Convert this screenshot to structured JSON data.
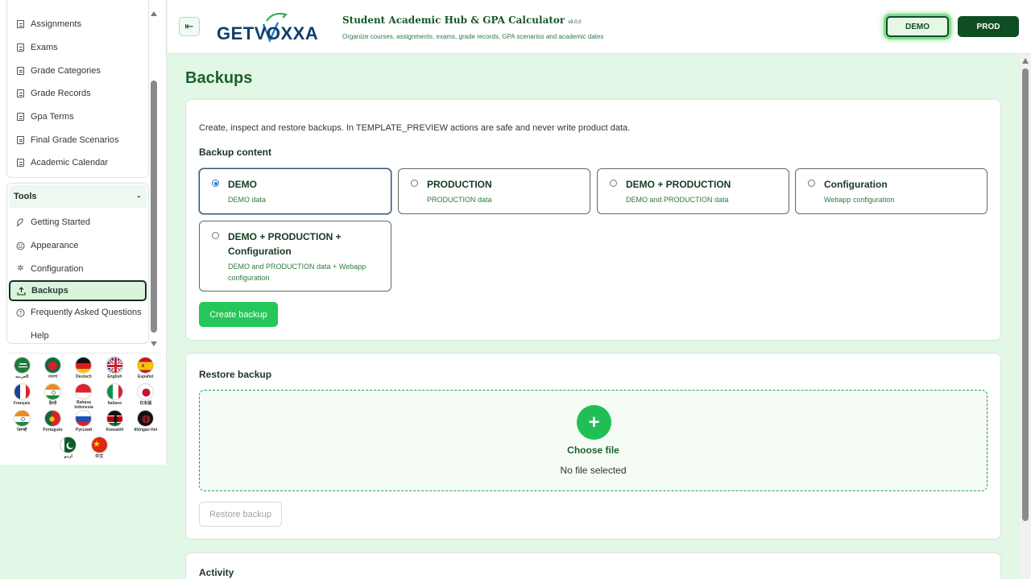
{
  "sidebar": {
    "nav_items": [
      "Assignments",
      "Exams",
      "Grade Categories",
      "Grade Records",
      "Gpa Terms",
      "Final Grade Scenarios",
      "Academic Calendar"
    ],
    "tools": {
      "heading": "Tools",
      "toggle": "-",
      "items": [
        {
          "label": "Getting Started",
          "icon": "rocket-icon"
        },
        {
          "label": "Appearance",
          "icon": "palette-icon"
        },
        {
          "label": "Configuration",
          "icon": "gear-icon"
        },
        {
          "label": "Backups",
          "icon": "upload-icon",
          "active": true
        },
        {
          "label": "Frequently Asked Questions",
          "icon": "question-icon"
        },
        {
          "label": "Help",
          "icon": ""
        }
      ]
    },
    "languages": [
      {
        "label": "العربية",
        "flag": "saudi-arabia"
      },
      {
        "label": "বাংলা",
        "flag": "bangladesh"
      },
      {
        "label": "Deutsch",
        "flag": "germany"
      },
      {
        "label": "English",
        "flag": "united-kingdom",
        "selected": true
      },
      {
        "label": "Español",
        "flag": "spain"
      },
      {
        "label": "Français",
        "flag": "france"
      },
      {
        "label": "हिन्दी",
        "flag": "india"
      },
      {
        "label": "Bahasa Indonesia",
        "flag": "indonesia"
      },
      {
        "label": "Italiano",
        "flag": "italy"
      },
      {
        "label": "日本語",
        "flag": "japan"
      },
      {
        "label": "ਪੰਜਾਬੀ",
        "flag": "india"
      },
      {
        "label": "Português",
        "flag": "portugal"
      },
      {
        "label": "Русский",
        "flag": "russia"
      },
      {
        "label": "Kiswahili",
        "flag": "kenya"
      },
      {
        "label": "tlhIngan Hol",
        "flag": "klingon"
      },
      {
        "label": "اردو",
        "flag": "pakistan"
      },
      {
        "label": "中文",
        "flag": "china"
      }
    ]
  },
  "header": {
    "logo_text": "GETVOXXA",
    "title": "Student Academic Hub & GPA Calculator",
    "version": "v9.0.0",
    "subtitle": "Organize courses, assignments, exams, grade records, GPA scenarios and academic dates",
    "env_demo": "DEMO",
    "env_prod": "PROD"
  },
  "page": {
    "title": "Backups",
    "backup": {
      "intro": "Create, inspect and restore backups. In TEMPLATE_PREVIEW actions are safe and never write product data.",
      "content_heading": "Backup content",
      "options": [
        {
          "title": "DEMO",
          "desc": "DEMO data",
          "selected": true
        },
        {
          "title": "PRODUCTION",
          "desc": "PRODUCTION data",
          "selected": false
        },
        {
          "title": "DEMO + PRODUCTION",
          "desc": "DEMO and PRODUCTION data",
          "selected": false
        },
        {
          "title": "Configuration",
          "desc": "Webapp configuration",
          "selected": false
        },
        {
          "title": "DEMO + PRODUCTION + Configuration",
          "desc": "DEMO and PRODUCTION data + Webapp configuration",
          "selected": false
        }
      ],
      "create_label": "Create backup"
    },
    "restore": {
      "heading": "Restore backup",
      "plus": "+",
      "choose_label": "Choose file",
      "status": "No file selected",
      "restore_label": "Restore backup"
    },
    "activity": {
      "heading": "Activity"
    }
  }
}
